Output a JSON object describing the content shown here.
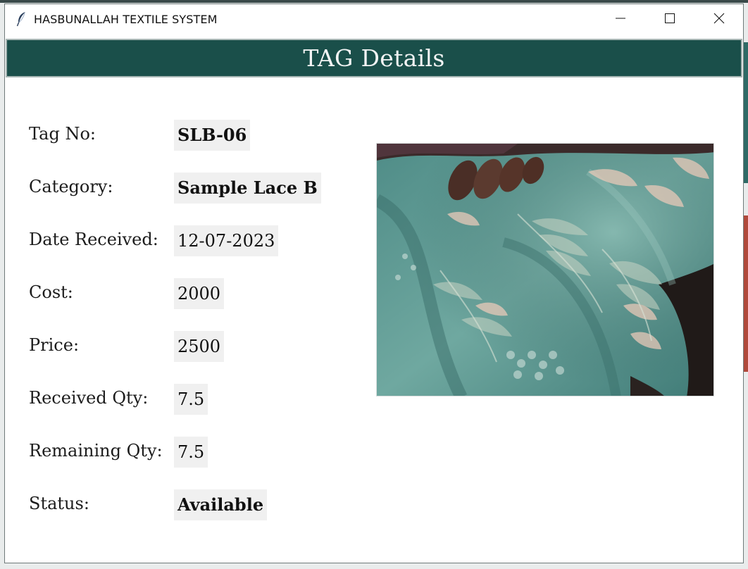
{
  "window": {
    "title": "HASBUNALLAH TEXTILE SYSTEM",
    "app_icon": "feather-icon",
    "controls": [
      "minimize-icon",
      "maximize-icon",
      "close-icon"
    ]
  },
  "header": {
    "title": "TAG Details",
    "background": "#1a4f4a"
  },
  "fields": [
    {
      "label": "Tag No:",
      "value": "SLB-06"
    },
    {
      "label": "Category:",
      "value": "Sample Lace B"
    },
    {
      "label": "Date Received:",
      "value": "12-07-2023"
    },
    {
      "label": "Cost:",
      "value": "2000"
    },
    {
      "label": "Price:",
      "value": "2500"
    },
    {
      "label": "Received Qty:",
      "value": "7.5"
    },
    {
      "label": "Remaining Qty:",
      "value": "7.5"
    },
    {
      "label": "Status:",
      "value": "Available"
    }
  ]
}
